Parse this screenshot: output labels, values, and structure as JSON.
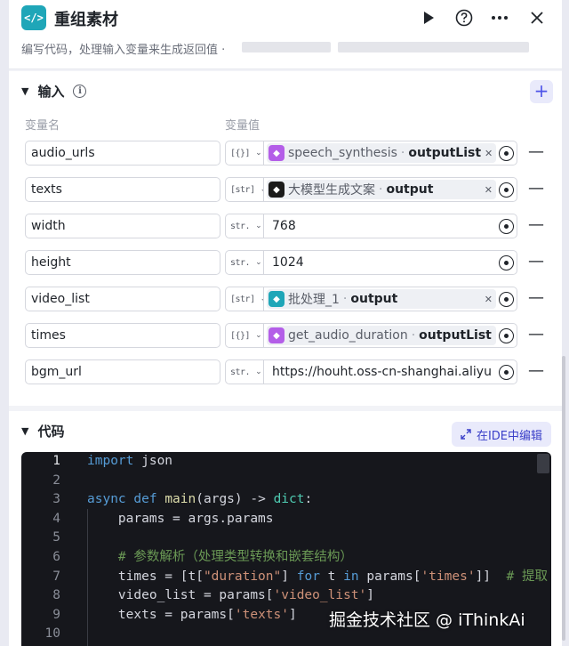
{
  "header": {
    "icon_glyph": "</>",
    "title": "重组素材",
    "description": "编写代码，处理输入变量来生成返回值 ·",
    "run_icon": "play-icon",
    "help_icon": "help-icon",
    "more_icon": "more-icon",
    "close_icon": "close-icon"
  },
  "input_section": {
    "title": "输入",
    "col_name": "变量名",
    "col_value": "变量值",
    "add_label": "+",
    "rows": [
      {
        "name": "audio_urls",
        "type": "[{}]",
        "kind": "ref",
        "node": "speech_synthesis",
        "field": "outputList",
        "icon_color": "#b45ee8"
      },
      {
        "name": "texts",
        "type": "[str]",
        "kind": "ref",
        "node": "大模型生成文案",
        "field": "output",
        "icon_color": "#1a1a1a"
      },
      {
        "name": "width",
        "type": "str.",
        "kind": "literal",
        "value": "768"
      },
      {
        "name": "height",
        "type": "str.",
        "kind": "literal",
        "value": "1024"
      },
      {
        "name": "video_list",
        "type": "[str]",
        "kind": "ref",
        "node": "批处理_1",
        "field": "output",
        "icon_color": "#1fa6b8"
      },
      {
        "name": "times",
        "type": "[{}]",
        "kind": "ref",
        "node": "get_audio_duration",
        "field": "outputList",
        "icon_color": "#b45ee8"
      },
      {
        "name": "bgm_url",
        "type": "str.",
        "kind": "literal",
        "value": "https://houht.oss-cn-shanghai.aliyu···"
      }
    ]
  },
  "code_section": {
    "title": "代码",
    "ide_button": "在IDE中编辑",
    "lines": [
      {
        "n": "1",
        "html": "<span class='k'>import</span> json"
      },
      {
        "n": "2",
        "html": ""
      },
      {
        "n": "3",
        "html": "<span class='k'>async</span> <span class='k'>def</span> <span class='f'>main</span>(args) -> <span class='t'>dict</span>:"
      },
      {
        "n": "4",
        "html": "    params = args.params"
      },
      {
        "n": "5",
        "html": ""
      },
      {
        "n": "6",
        "html": "    <span class='c'># 参数解析（处理类型转换和嵌套结构）</span>"
      },
      {
        "n": "7",
        "html": "    times = [t[<span class='s'>\"duration\"</span>] <span class='k'>for</span> t <span class='k'>in</span> params[<span class='s'>'times'</span>]]  <span class='c'># 提取</span>"
      },
      {
        "n": "8",
        "html": "    video_list = params[<span class='s'>'video_list'</span>]"
      },
      {
        "n": "9",
        "html": "    texts = params[<span class='s'>'texts'</span>]"
      },
      {
        "n": "10",
        "html": ""
      }
    ]
  },
  "watermark": "掘金技术社区 @ iThinkAi"
}
